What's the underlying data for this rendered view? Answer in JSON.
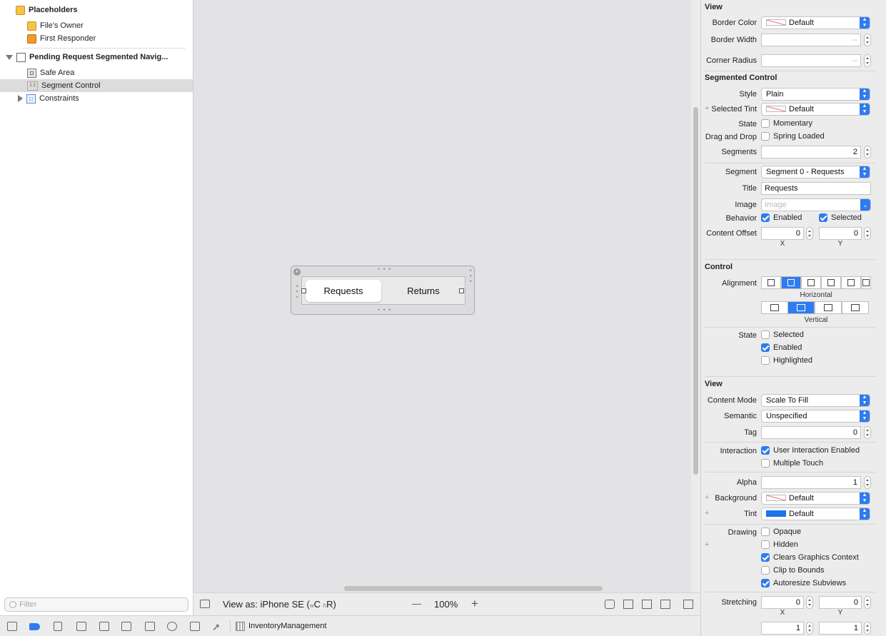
{
  "outline": {
    "placeholders": "Placeholders",
    "files_owner": "File's Owner",
    "first_responder": "First Responder",
    "view_title": "Pending Request Segmented Navig...",
    "safe_area": "Safe Area",
    "segment_control": "Segment Control",
    "segment_icon": "1 2",
    "constraints": "Constraints",
    "filter_placeholder": "Filter"
  },
  "canvas": {
    "segments": [
      "Requests",
      "Returns"
    ],
    "selected_segment": 0
  },
  "canvas_bar": {
    "view_as": "View as: iPhone SE (",
    "w_label": "w",
    "c_label": "C",
    "h_label": "h",
    "r_label": "R)",
    "zoom_out": "—",
    "zoom": "100%",
    "zoom_in": "+"
  },
  "bottom_bar": {
    "scheme": "InventoryManagement"
  },
  "inspector": {
    "view_section": "View",
    "border_color_label": "Border Color",
    "border_color_value": "Default",
    "border_width_label": "Border Width",
    "border_width_placeholder": "--",
    "corner_radius_label": "Corner Radius",
    "corner_radius_placeholder": "--",
    "segmented_section": "Segmented Control",
    "style_label": "Style",
    "style_value": "Plain",
    "selected_tint_label": "Selected Tint",
    "selected_tint_value": "Default",
    "state_label": "State",
    "momentary": "Momentary",
    "drag_drop_label": "Drag and Drop",
    "spring_loaded": "Spring Loaded",
    "segments_label": "Segments",
    "segments_value": "2",
    "segment_label": "Segment",
    "segment_value": "Segment 0 - Requests",
    "title_label": "Title",
    "title_value": "Requests",
    "image_label": "Image",
    "image_placeholder": "Image",
    "behavior_label": "Behavior",
    "enabled": "Enabled",
    "selected": "Selected",
    "content_offset_label": "Content Offset",
    "offset_x": "0",
    "offset_y": "0",
    "x_label": "X",
    "y_label": "Y",
    "control_section": "Control",
    "alignment_label": "Alignment",
    "horizontal": "Horizontal",
    "vertical": "Vertical",
    "control_state_label": "State",
    "ctl_selected": "Selected",
    "ctl_enabled": "Enabled",
    "ctl_highlighted": "Highlighted",
    "view2_section": "View",
    "content_mode_label": "Content Mode",
    "content_mode_value": "Scale To Fill",
    "semantic_label": "Semantic",
    "semantic_value": "Unspecified",
    "tag_label": "Tag",
    "tag_value": "0",
    "interaction_label": "Interaction",
    "user_interaction": "User Interaction Enabled",
    "multiple_touch": "Multiple Touch",
    "alpha_label": "Alpha",
    "alpha_value": "1",
    "background_label": "Background",
    "background_value": "Default",
    "tint_label": "Tint",
    "tint_value": "Default",
    "drawing_label": "Drawing",
    "opaque": "Opaque",
    "hidden": "Hidden",
    "clears_graphics": "Clears Graphics Context",
    "clip_bounds": "Clip to Bounds",
    "autoresize": "Autoresize Subviews",
    "stretching_label": "Stretching",
    "stretch_x": "0",
    "stretch_y": "0",
    "stretch_w": "1",
    "stretch_h": "1",
    "plus": "+"
  },
  "colors": {
    "accent": "#2f7bf0",
    "selection_row": "#dcdcdc",
    "canvas_bg": "#e3e3e6"
  }
}
